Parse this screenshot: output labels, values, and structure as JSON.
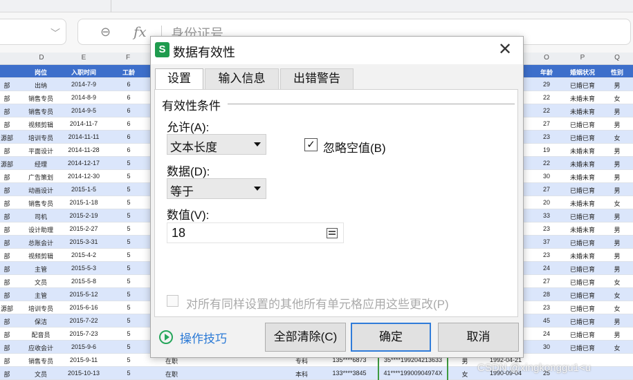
{
  "formula": {
    "value": "身份证号"
  },
  "columns": [
    "D",
    "E",
    "F",
    "O",
    "P",
    "Q"
  ],
  "header_row": {
    "dept": "",
    "post": "岗位",
    "date": "入职时间",
    "years": "工龄",
    "age": "年龄",
    "marriage": "婚姻状况",
    "gender": "性别"
  },
  "rows": [
    {
      "dept": "部",
      "post": "出纳",
      "date": "2014-7-9",
      "years": "6",
      "age": "29",
      "marriage": "已婚已育",
      "gender": "男"
    },
    {
      "dept": "部",
      "post": "销售专员",
      "date": "2014-8-9",
      "years": "6",
      "age": "22",
      "marriage": "未婚未育",
      "gender": "女"
    },
    {
      "dept": "部",
      "post": "销售专员",
      "date": "2014-9-5",
      "years": "6",
      "age": "22",
      "marriage": "未婚未育",
      "gender": "男"
    },
    {
      "dept": "部",
      "post": "视频剪辑",
      "date": "2014-11-7",
      "years": "6",
      "age": "27",
      "marriage": "已婚已育",
      "gender": "男"
    },
    {
      "dept": "源部",
      "post": "培训专员",
      "date": "2014-11-11",
      "years": "6",
      "age": "23",
      "marriage": "已婚已育",
      "gender": "女"
    },
    {
      "dept": "部",
      "post": "平面设计",
      "date": "2014-11-28",
      "years": "6",
      "age": "19",
      "marriage": "未婚未育",
      "gender": "男"
    },
    {
      "dept": "源部",
      "post": "经理",
      "date": "2014-12-17",
      "years": "5",
      "age": "22",
      "marriage": "未婚未育",
      "gender": "男"
    },
    {
      "dept": "部",
      "post": "广告策划",
      "date": "2014-12-30",
      "years": "5",
      "age": "30",
      "marriage": "未婚未育",
      "gender": "男"
    },
    {
      "dept": "部",
      "post": "动画设计",
      "date": "2015-1-5",
      "years": "5",
      "age": "27",
      "marriage": "已婚已育",
      "gender": "男"
    },
    {
      "dept": "部",
      "post": "销售专员",
      "date": "2015-1-18",
      "years": "5",
      "age": "20",
      "marriage": "未婚未育",
      "gender": "女"
    },
    {
      "dept": "部",
      "post": "司机",
      "date": "2015-2-19",
      "years": "5",
      "age": "33",
      "marriage": "已婚已育",
      "gender": "男"
    },
    {
      "dept": "部",
      "post": "设计助理",
      "date": "2015-2-27",
      "years": "5",
      "age": "23",
      "marriage": "未婚未育",
      "gender": "男"
    },
    {
      "dept": "部",
      "post": "总账会计",
      "date": "2015-3-31",
      "years": "5",
      "age": "37",
      "marriage": "已婚已育",
      "gender": "男"
    },
    {
      "dept": "部",
      "post": "视频剪辑",
      "date": "2015-4-2",
      "years": "5",
      "age": "23",
      "marriage": "未婚未育",
      "gender": "男"
    },
    {
      "dept": "部",
      "post": "主管",
      "date": "2015-5-3",
      "years": "5",
      "age": "24",
      "marriage": "已婚已育",
      "gender": "男"
    },
    {
      "dept": "部",
      "post": "文员",
      "date": "2015-5-8",
      "years": "5",
      "age": "27",
      "marriage": "已婚已育",
      "gender": "女"
    },
    {
      "dept": "部",
      "post": "主管",
      "date": "2015-5-12",
      "years": "5",
      "age": "28",
      "marriage": "已婚已育",
      "gender": "女"
    },
    {
      "dept": "源部",
      "post": "培训专员",
      "date": "2015-6-16",
      "years": "5",
      "age": "23",
      "marriage": "已婚已育",
      "gender": "女"
    },
    {
      "dept": "部",
      "post": "保洁",
      "date": "2015-7-22",
      "years": "5",
      "age": "45",
      "marriage": "已婚已育",
      "gender": "男"
    },
    {
      "dept": "部",
      "post": "配音员",
      "date": "2015-7-23",
      "years": "5",
      "age": "24",
      "marriage": "已婚已育",
      "gender": "男"
    },
    {
      "dept": "部",
      "post": "应收会计",
      "date": "2015-9-6",
      "years": "5",
      "age": "30",
      "marriage": "已婚已育",
      "gender": "女"
    }
  ],
  "bottom_rows": [
    {
      "dept": "部",
      "post": "销售专员",
      "date": "2015-9-11",
      "years": "5",
      "status": "在职",
      "edu": "专科",
      "phone": "135****6873",
      "id": "35****199204213633",
      "sex": "男",
      "birth": "1992-04-21",
      "age": "",
      "marriage": "",
      "gender": ""
    },
    {
      "dept": "部",
      "post": "文员",
      "date": "2015-10-13",
      "years": "5",
      "status": "在职",
      "edu": "本科",
      "phone": "133****3845",
      "id": "41****19900904974X",
      "sex": "女",
      "birth": "1990-09-04",
      "age": "25",
      "marriage": "",
      "gender": ""
    }
  ],
  "dialog": {
    "title": "数据有效性",
    "close_icon": "close-icon",
    "tabs": [
      "设置",
      "输入信息",
      "出错警告"
    ],
    "group_label": "有效性条件",
    "allow_label": "允许(A):",
    "allow_value": "文本长度",
    "ignore_blank_label": "忽略空值(B)",
    "ignore_blank_checked": "✓",
    "data_label": "数据(D):",
    "data_value": "等于",
    "value_label": "数值(V):",
    "value_value": "18",
    "apply_all_label": "对所有同样设置的其他所有单元格应用这些更改(P)",
    "tips_label": "操作技巧",
    "clear_all_label": "全部清除(C)",
    "ok_label": "确定",
    "cancel_label": "取消"
  },
  "watermark": "CSDN @xingkonggu1<u"
}
